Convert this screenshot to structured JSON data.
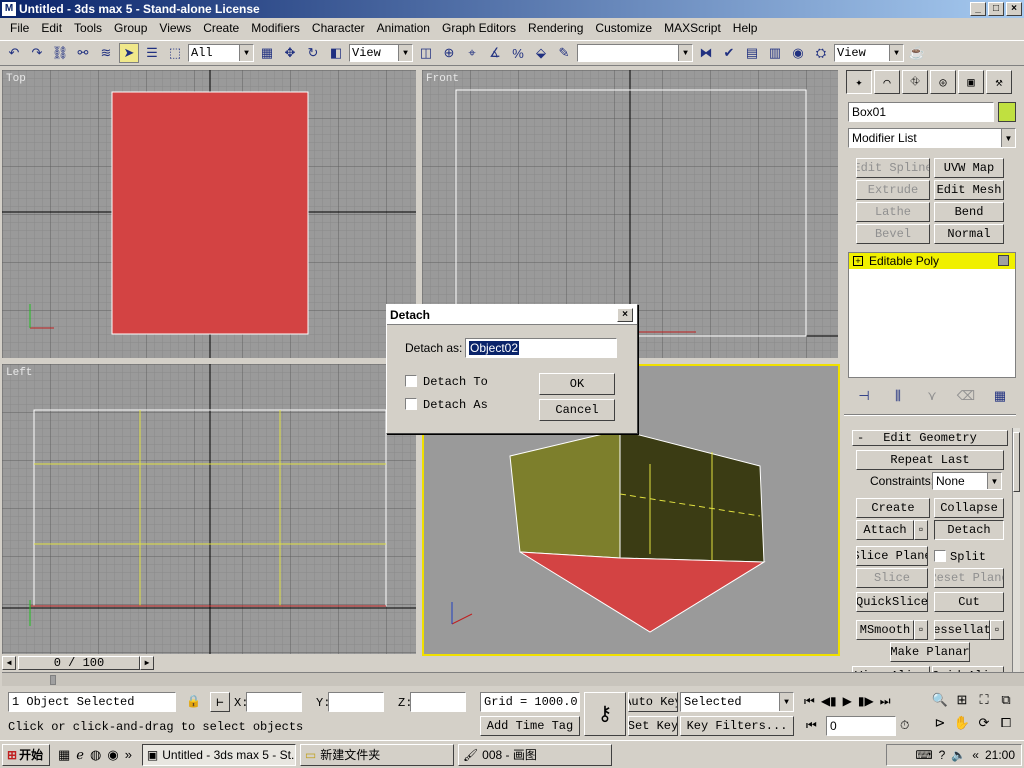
{
  "window": {
    "title": "Untitled - 3ds max 5 - Stand-alone License",
    "minimize": "_",
    "maximize": "□",
    "close": "×"
  },
  "menu": [
    "File",
    "Edit",
    "Tools",
    "Group",
    "Views",
    "Create",
    "Modifiers",
    "Character",
    "Animation",
    "Graph Editors",
    "Rendering",
    "Customize",
    "MAXScript",
    "Help"
  ],
  "toolbar": {
    "selection_filter": "All",
    "ref_coord": "View",
    "named_selection": "",
    "render_type": "View"
  },
  "viewports": {
    "top": "Top",
    "front": "Front",
    "left": "Left"
  },
  "colors": {
    "object_red": "#d34343",
    "wall_olive": "#7d7f2c",
    "wall_dark": "#3b3c14",
    "grid_bg": "#9a9a9a",
    "active_border": "#f0e000"
  },
  "panel": {
    "object_name": "Box01",
    "modifier_list": "Modifier List",
    "modifier_buttons": [
      {
        "label": "Edit Spline",
        "enabled": false
      },
      {
        "label": "UVW Map",
        "enabled": true
      },
      {
        "label": "Extrude",
        "enabled": false
      },
      {
        "label": "Edit Mesh",
        "enabled": true
      },
      {
        "label": "Lathe",
        "enabled": false
      },
      {
        "label": "Bend",
        "enabled": true
      },
      {
        "label": "Bevel",
        "enabled": false
      },
      {
        "label": "Normal",
        "enabled": true
      }
    ],
    "stack_item": "Editable Poly",
    "rollout_title": "Edit Geometry",
    "repeat_last": "Repeat Last",
    "constraints_label": "Constraints:",
    "constraints_value": "None",
    "create": "Create",
    "collapse": "Collapse",
    "attach": "Attach",
    "detach": "Detach",
    "slice_plane": "Slice Plane",
    "split": "Split",
    "slice": "Slice",
    "reset_plane": "Reset Plane",
    "quickslice": "QuickSlice",
    "cut": "Cut",
    "msmooth": "MSmooth",
    "tessellate": "Tessellate",
    "make_planar": "Make Planar",
    "view_align": "View Align",
    "grid_align": "Grid Align"
  },
  "dialog": {
    "title": "Detach",
    "detach_as_label": "Detach as:",
    "detach_as_value": "Object02",
    "detach_to_element": "Detach To",
    "detach_as_clone": "Detach As",
    "ok": "OK",
    "cancel": "Cancel"
  },
  "timeline": {
    "frame": "0 / 100"
  },
  "status": {
    "selection": "1 Object Selected",
    "prompt": "Click or click-and-drag to select objects",
    "x_label": "X:",
    "y_label": "Y:",
    "z_label": "Z:",
    "x_value": "",
    "y_value": "",
    "z_value": "",
    "grid": "Grid = 1000.0",
    "add_time_tag": "Add Time Tag",
    "auto_key": "Auto Key",
    "set_key": "Set Key",
    "selected": "Selected",
    "key_filters": "Key Filters...",
    "current_frame": "0"
  },
  "taskbar": {
    "start": "开始",
    "tasks": [
      "Untitled - 3ds max 5 - St...",
      "新建文件夹",
      "008 - 画图"
    ],
    "clock": "21:00"
  }
}
